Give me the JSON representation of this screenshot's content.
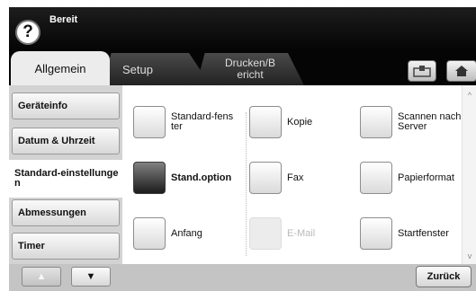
{
  "header": {
    "help_label": "?",
    "status": "Bereit"
  },
  "tabs": [
    {
      "label": "Allgemein",
      "active": true
    },
    {
      "label": "Setup",
      "active": false
    },
    {
      "label": "Drucken/Bericht",
      "active": false
    }
  ],
  "toolbar": {
    "stamp_icon": "job-status-icon",
    "home_icon": "home-icon"
  },
  "sidebar": {
    "items": [
      {
        "label": "Geräteinfo"
      },
      {
        "label": "Datum & Uhrzeit"
      },
      {
        "label": "Standard-einstellungen",
        "selected": true
      },
      {
        "label": "Abmessungen"
      },
      {
        "label": "Timer"
      }
    ],
    "nav_up": "▲",
    "nav_down": "▼"
  },
  "options": [
    {
      "label": "Standard-fenster"
    },
    {
      "label": "Kopie"
    },
    {
      "label": "Scannen nach Server"
    },
    {
      "label": "Stand.option",
      "selected": true
    },
    {
      "label": "Fax"
    },
    {
      "label": "Papierformat"
    },
    {
      "label": "Anfang"
    },
    {
      "label": "E-Mail",
      "disabled": true
    },
    {
      "label": "Startfenster"
    }
  ],
  "scroll": {
    "up": "^",
    "down": "v"
  },
  "footer": {
    "back_label": "Zurück"
  },
  "colors": {
    "selected_option": "#2a2a2a",
    "header_bg": "#000000",
    "sidebar_bg": "#d3d3d3"
  }
}
